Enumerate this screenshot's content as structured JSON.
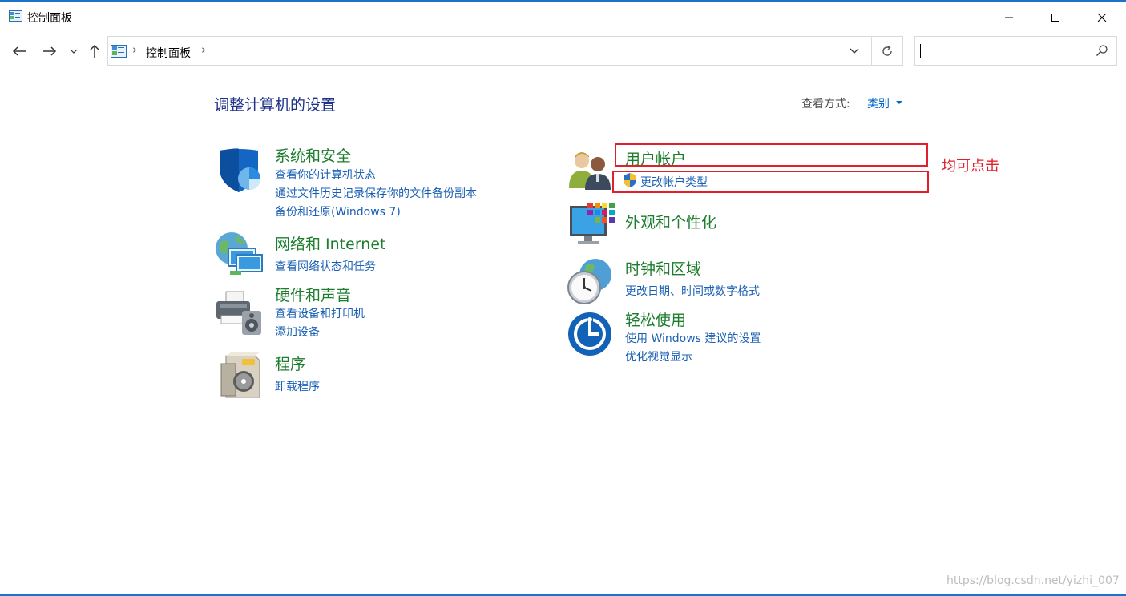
{
  "window": {
    "title": "控制面板",
    "controls": {
      "minimize": "minimize",
      "maximize": "maximize",
      "close": "close"
    }
  },
  "nav": {
    "back": "back",
    "forward": "forward",
    "recent": "recent",
    "up": "up",
    "address": {
      "path_label": "控制面板",
      "separator": "›"
    },
    "search": {
      "placeholder": ""
    }
  },
  "content": {
    "heading": "调整计算机的设置",
    "view_by_label": "查看方式:",
    "view_by_value": "类别",
    "left_categories": [
      {
        "title": "系统和安全",
        "icon": "shield-icon",
        "links": [
          "查看你的计算机状态",
          "通过文件历史记录保存你的文件备份副本",
          "备份和还原(Windows 7)"
        ]
      },
      {
        "title": "网络和 Internet",
        "icon": "network-globe-icon",
        "links": [
          "查看网络状态和任务"
        ]
      },
      {
        "title": "硬件和声音",
        "icon": "printer-speaker-icon",
        "links": [
          "查看设备和打印机",
          "添加设备"
        ]
      },
      {
        "title": "程序",
        "icon": "programs-box-icon",
        "links": [
          "卸载程序"
        ]
      }
    ],
    "right_categories": [
      {
        "title": "用户帐户",
        "icon": "users-icon",
        "links": [
          "更改帐户类型"
        ]
      },
      {
        "title": "外观和个性化",
        "icon": "monitor-palette-icon",
        "links": []
      },
      {
        "title": "时钟和区域",
        "icon": "clock-globe-icon",
        "links": [
          "更改日期、时间或数字格式"
        ]
      },
      {
        "title": "轻松使用",
        "icon": "ease-of-access-icon",
        "links": [
          "使用 Windows 建议的设置",
          "优化视觉显示"
        ]
      }
    ]
  },
  "annotation": {
    "text": "均可点击",
    "color": "#e0202a"
  },
  "watermark": "https://blog.csdn.net/yizhi_007",
  "colors": {
    "category_title": "#1c7d2d",
    "link": "#1a5fb4",
    "heading": "#1e3287",
    "accent": "#1a73c8"
  }
}
